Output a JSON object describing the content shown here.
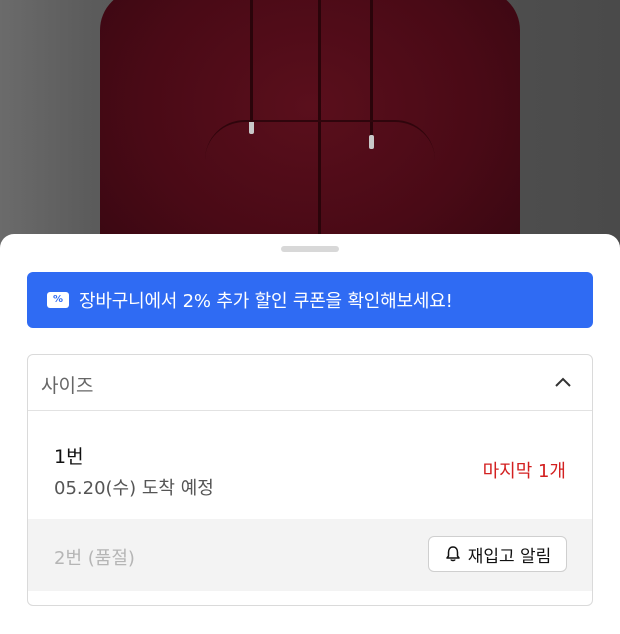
{
  "product_image": {
    "description_icon": "burgundy-zip-hoodie-photo"
  },
  "coupon_banner": {
    "icon": "coupon-percent-icon",
    "icon_glyph": "%",
    "text": "장바구니에서 2% 추가 할인 쿠폰을 확인해보세요!",
    "bg_color": "#2f6bf3"
  },
  "size_select": {
    "label": "사이즈",
    "icon": "chevron-up-icon",
    "options": [
      {
        "name": "1번",
        "delivery": "05.20(수) 도착 예정",
        "badge": "마지막 1개",
        "badge_color": "#d32020"
      },
      {
        "name": "2번 (품절)",
        "button_label": "재입고 알림",
        "button_icon": "bell-icon"
      }
    ]
  }
}
